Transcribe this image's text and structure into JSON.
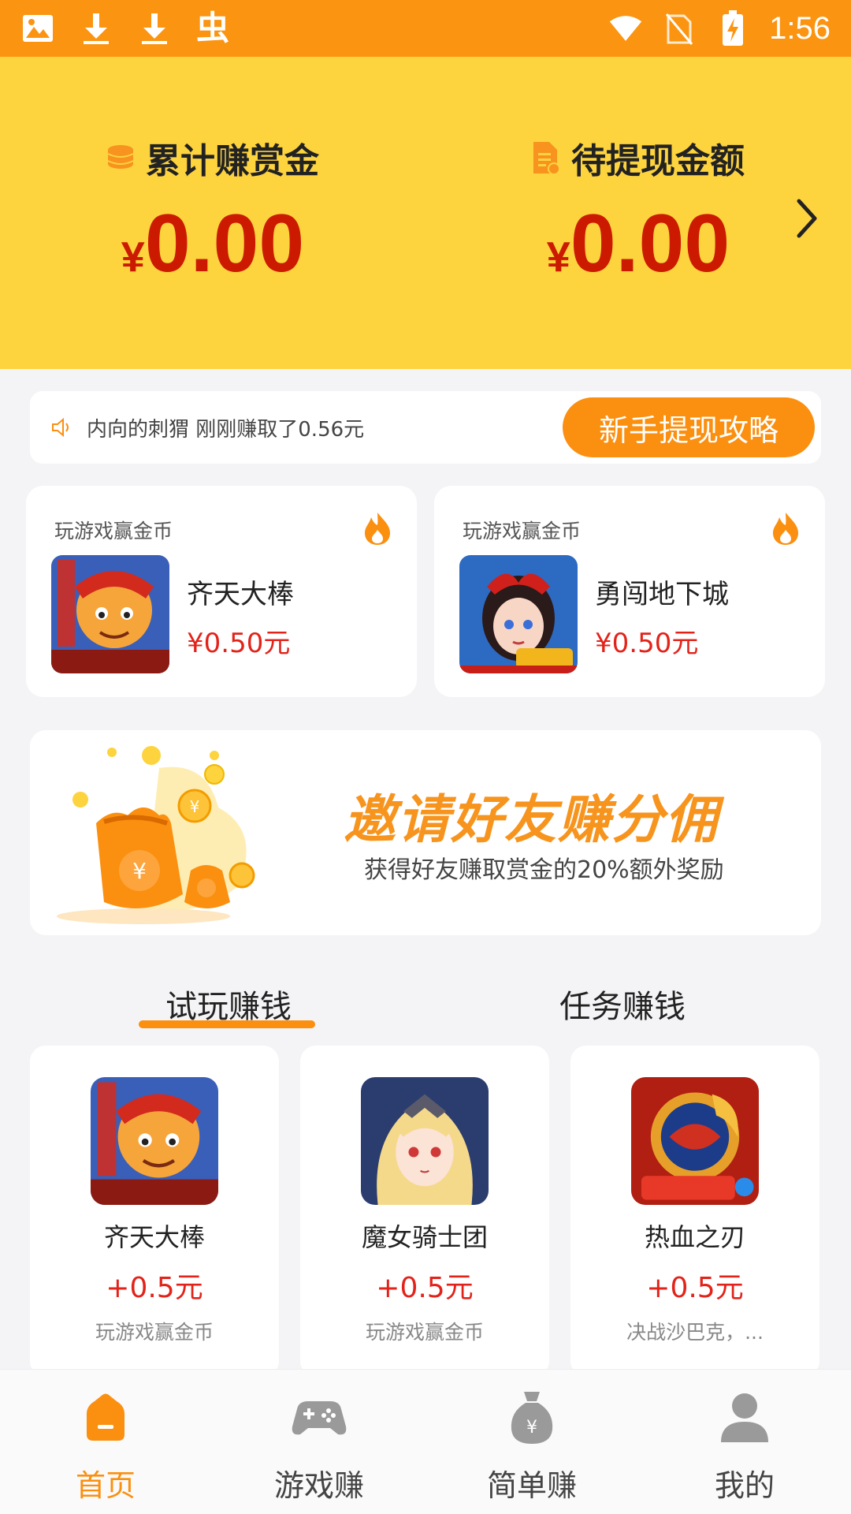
{
  "status_bar": {
    "time": "1:56",
    "app_glyph": "虫"
  },
  "earnings": {
    "total": {
      "label": "累计赚赏金",
      "currency": "¥",
      "amount": "0.00",
      "icon": "coin-stack-icon"
    },
    "pending": {
      "label": "待提现金额",
      "currency": "¥",
      "amount": "0.00",
      "icon": "document-icon"
    }
  },
  "notice": {
    "text": "内向的刺猬 刚刚赚取了0.56元",
    "button": "新手提现攻略"
  },
  "featured": [
    {
      "label": "玩游戏赢金币",
      "name": "齐天大棒",
      "price": "¥0.50元"
    },
    {
      "label": "玩游戏赢金币",
      "name": "勇闯地下城",
      "price": "¥0.50元"
    }
  ],
  "invite": {
    "title": "邀请好友赚分佣",
    "subtitle": "获得好友赚取赏金的20%额外奖励"
  },
  "tabs": [
    {
      "label": "试玩赚钱",
      "active": true
    },
    {
      "label": "任务赚钱",
      "active": false
    }
  ],
  "games": [
    {
      "name": "齐天大棒",
      "reward": "+0.5元",
      "desc": "玩游戏赢金币"
    },
    {
      "name": "魔女骑士团",
      "reward": "+0.5元",
      "desc": "玩游戏赢金币"
    },
    {
      "name": "热血之刃",
      "reward": "+0.5元",
      "desc": "决战沙巴克，..."
    }
  ],
  "nav": [
    {
      "label": "首页",
      "icon": "home-icon",
      "active": true
    },
    {
      "label": "游戏赚",
      "icon": "gamepad-icon",
      "active": false
    },
    {
      "label": "简单赚",
      "icon": "money-bag-icon",
      "active": false
    },
    {
      "label": "我的",
      "icon": "user-icon",
      "active": false
    }
  ],
  "colors": {
    "status_bar": "#fb9410",
    "header": "#fdd33e",
    "accent": "#fb8f0f",
    "price": "#e2231a",
    "amount": "#cc1a00"
  }
}
